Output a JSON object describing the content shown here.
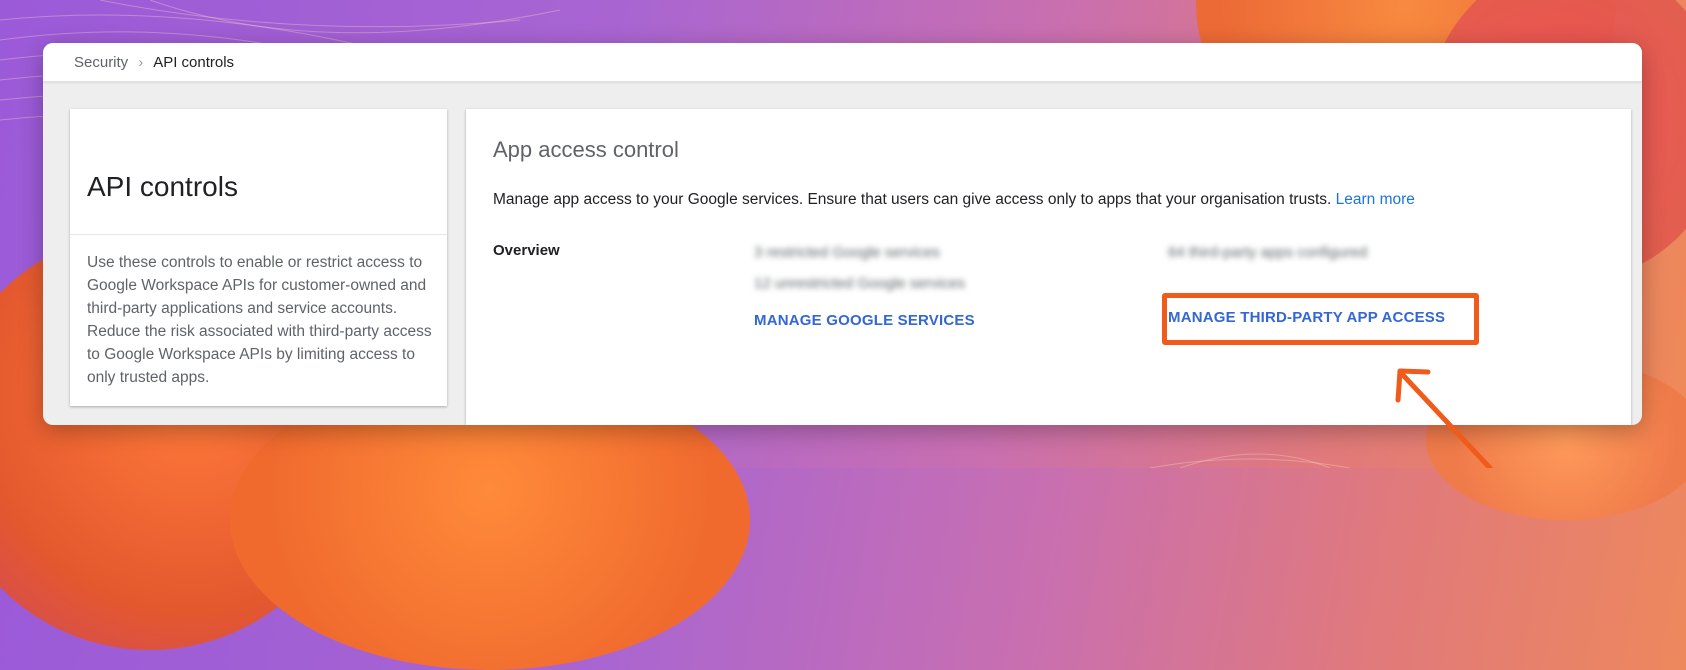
{
  "breadcrumb": {
    "parent": "Security",
    "separator": "›",
    "current": "API controls"
  },
  "sidebar_card": {
    "title": "API controls",
    "description": "Use these controls to enable or restrict access to Google Workspace APIs for customer-owned and third-party applications and service accounts. Reduce the risk associated with third-party access to Google Workspace APIs by limiting access to only trusted apps."
  },
  "app_access": {
    "title": "App access control",
    "intro": "Manage app access to your Google services. Ensure that users can give access only to apps that your organisation trusts.",
    "learn_more": "Learn more",
    "overview_label": "Overview",
    "google_services": {
      "restricted_text": "3 restricted Google services",
      "unrestricted_text": "12 unrestricted Google services",
      "manage_label": "MANAGE GOOGLE SERVICES"
    },
    "third_party": {
      "configured_text": "64 third-party apps configured",
      "manage_label": "MANAGE THIRD-PARTY APP ACCESS"
    }
  },
  "colors": {
    "highlight": "#f05a1a",
    "link": "#1a73e8",
    "action_link": "#3367d6"
  }
}
